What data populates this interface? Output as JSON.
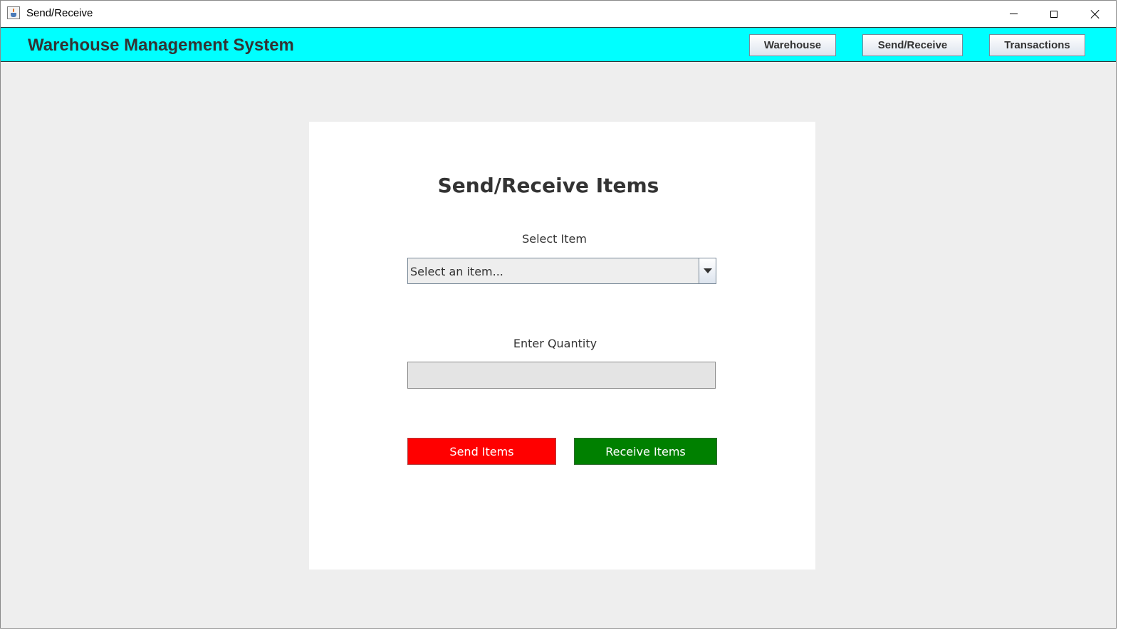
{
  "window": {
    "title": "Send/Receive",
    "controls": [
      "minimize-icon",
      "maximize-icon",
      "close-icon"
    ]
  },
  "header": {
    "app_title": "Warehouse Management System",
    "background_color": "#00ffff",
    "nav": {
      "warehouse": "Warehouse",
      "send_receive": "Send/Receive",
      "transactions": "Transactions"
    }
  },
  "form": {
    "title": "Send/Receive Items",
    "item_label": "Select Item",
    "item_select_value": "Select an item...",
    "quantity_label": "Enter Quantity",
    "quantity_value": "",
    "send_button": "Send Items",
    "send_color": "#ff0000",
    "receive_button": "Receive Items",
    "receive_color": "#008000"
  }
}
